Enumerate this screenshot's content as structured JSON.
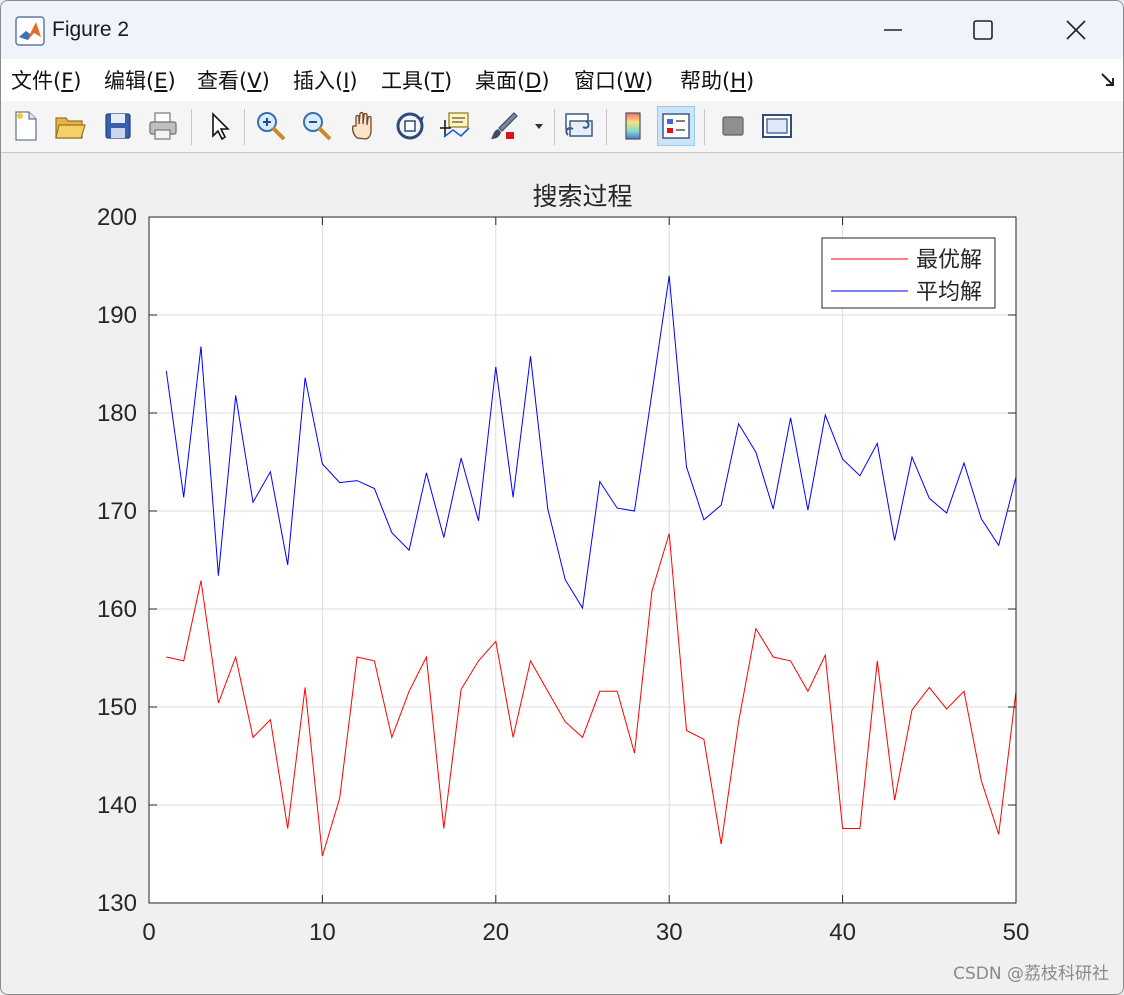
{
  "window": {
    "title": "Figure 2"
  },
  "menu": [
    {
      "label": "文件(",
      "accel": "F",
      "tail": ")"
    },
    {
      "label": "编辑(",
      "accel": "E",
      "tail": ")"
    },
    {
      "label": "查看(",
      "accel": "V",
      "tail": ")"
    },
    {
      "label": "插入(",
      "accel": "I",
      "tail": ")"
    },
    {
      "label": "工具(",
      "accel": "T",
      "tail": ")"
    },
    {
      "label": "桌面(",
      "accel": "D",
      "tail": ")"
    },
    {
      "label": "窗口(",
      "accel": "W",
      "tail": ")"
    },
    {
      "label": "帮助(",
      "accel": "H",
      "tail": ")"
    }
  ],
  "toolbar": [
    "new-figure-icon",
    "open-file-icon",
    "save-icon",
    "print-icon",
    "edit-plot-arrow-icon",
    "zoom-in-icon",
    "zoom-out-icon",
    "pan-hand-icon",
    "rotate-3d-icon",
    "data-cursor-icon",
    "brush-icon",
    "link-plot-icon",
    "colorbar-icon",
    "legend-icon",
    "hide-plot-tools-icon",
    "show-plot-tools-icon"
  ],
  "watermark": "CSDN @荔枝科研社",
  "chart_data": {
    "type": "line",
    "title": "搜索过程",
    "xlabel": "",
    "ylabel": "",
    "xlim": [
      0,
      50
    ],
    "ylim": [
      130,
      200
    ],
    "xticks": [
      0,
      10,
      20,
      30,
      40,
      50
    ],
    "yticks": [
      130,
      140,
      150,
      160,
      170,
      180,
      190,
      200
    ],
    "grid": true,
    "legend_position": "top-right",
    "x": [
      1,
      2,
      3,
      4,
      5,
      6,
      7,
      8,
      9,
      10,
      11,
      12,
      13,
      14,
      15,
      16,
      17,
      18,
      19,
      20,
      21,
      22,
      23,
      24,
      25,
      26,
      27,
      28,
      29,
      30,
      31,
      32,
      33,
      34,
      35,
      36,
      37,
      38,
      39,
      40,
      41,
      42,
      43,
      44,
      45,
      46,
      47,
      48,
      49,
      50
    ],
    "series": [
      {
        "name": "最优解",
        "color": "#ff0000",
        "values": [
          155.1,
          154.7,
          162.9,
          150.4,
          155.1,
          146.9,
          148.7,
          137.6,
          152.0,
          134.8,
          140.7,
          155.1,
          154.7,
          146.9,
          151.6,
          155.1,
          137.6,
          151.8,
          154.7,
          156.7,
          146.9,
          154.7,
          151.6,
          148.5,
          146.9,
          151.6,
          151.6,
          145.3,
          161.8,
          167.7,
          147.6,
          146.7,
          136.0,
          148.5,
          158.0,
          155.1,
          154.7,
          151.6,
          155.3,
          137.6,
          137.6,
          154.7,
          140.5,
          149.7,
          152.0,
          149.8,
          151.6,
          142.5,
          137.0,
          151.6
        ]
      },
      {
        "name": "平均解",
        "color": "#0000ff",
        "values": [
          184.3,
          171.4,
          186.8,
          163.4,
          181.8,
          170.9,
          174.0,
          164.5,
          183.6,
          174.8,
          172.9,
          173.1,
          172.3,
          167.8,
          166.0,
          173.9,
          167.3,
          175.4,
          169.0,
          184.7,
          171.4,
          185.8,
          170.2,
          163.0,
          160.1,
          173.0,
          170.3,
          170.0,
          182.0,
          194.0,
          174.5,
          169.1,
          170.6,
          178.9,
          176.0,
          170.2,
          179.5,
          170.1,
          179.8,
          175.3,
          173.6,
          176.9,
          167.0,
          175.5,
          171.3,
          169.8,
          174.9,
          169.2,
          166.5,
          173.5
        ]
      }
    ]
  }
}
